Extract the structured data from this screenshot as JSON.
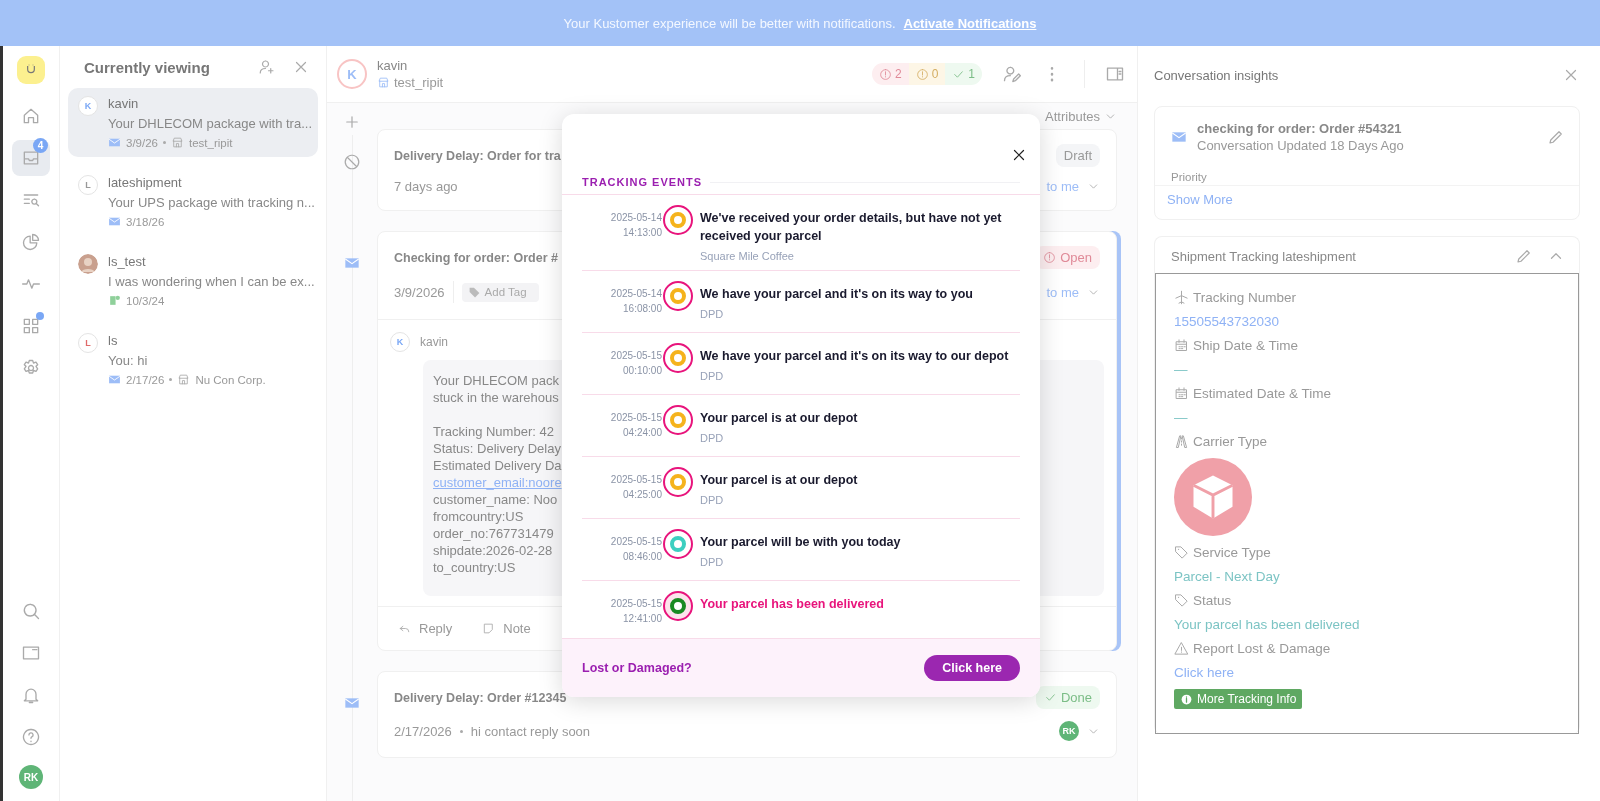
{
  "banner": {
    "text": "Your Kustomer experience will be better with notifications.",
    "link": "Activate Notifications"
  },
  "rail": {
    "top": [
      {
        "kind": "home",
        "selected": false
      },
      {
        "kind": "inbox",
        "selected": true,
        "badge": "4"
      },
      {
        "kind": "search-list",
        "selected": false
      },
      {
        "kind": "pie",
        "selected": false
      },
      {
        "kind": "pulse",
        "selected": false
      },
      {
        "kind": "apps",
        "selected": false,
        "dot": true
      },
      {
        "kind": "settings",
        "selected": false
      }
    ],
    "bottom": [
      {
        "kind": "search"
      },
      {
        "kind": "window"
      },
      {
        "kind": "bell"
      },
      {
        "kind": "help"
      }
    ],
    "user": "RK"
  },
  "list": {
    "title": "Currently viewing",
    "items": [
      {
        "kind": "email",
        "initial": "K",
        "color": "#7aa7f5",
        "name": "kavin",
        "preview": "Your DHLECOM package with tra...",
        "date": "3/9/26",
        "org": "test_ripit",
        "selected": true
      },
      {
        "kind": "email",
        "initial": "L",
        "color": "#999999",
        "name": "lateshipment",
        "preview": "Your UPS package with tracking n...",
        "date": "3/18/26",
        "selected": false
      },
      {
        "kind": "chat",
        "color": "#c9a08e",
        "name": "ls_test",
        "preview": "I was wondering when I can be ex...",
        "date": "10/3/24",
        "selected": false
      },
      {
        "kind": "email",
        "initial": "L",
        "color": "#e06a6a",
        "name": "ls",
        "preview": "You: hi",
        "date": "2/17/26",
        "org": "Nu Con Corp.",
        "selected": false
      }
    ]
  },
  "header": {
    "initial": "K",
    "name": "kavin",
    "org": "test_ripit",
    "counts": [
      {
        "kind": "urgent",
        "value": "2"
      },
      {
        "kind": "warning",
        "value": "0"
      },
      {
        "kind": "done",
        "value": "1"
      }
    ]
  },
  "filter": "Attributes",
  "cards": [
    {
      "kind": "draft",
      "title": "Delivery Delay: Order for tra",
      "status": "Draft",
      "date": "7 days ago",
      "assign": "to me",
      "selected": false
    },
    {
      "kind": "open",
      "title": "Checking for order: Order #",
      "status": "Open",
      "date": "3/9/2026",
      "tag": "Add Tag",
      "assign": "to me",
      "selected": true,
      "message": {
        "initial": "K",
        "author": "kavin",
        "lines": [
          {
            "text": "Your DHLECOM pack",
            "kind": "text"
          },
          {
            "text": "stuck in the warehous",
            "kind": "text"
          },
          {
            "kind": "gap"
          },
          {
            "text": "Tracking Number: 42",
            "kind": "text"
          },
          {
            "text": "Status: Delivery Delay",
            "kind": "text"
          },
          {
            "text": "Estimated Delivery Da",
            "kind": "text"
          },
          {
            "text": "customer_email:noore",
            "kind": "link"
          },
          {
            "text": "customer_name: Noo",
            "kind": "text"
          },
          {
            "text": "fromcountry:US",
            "kind": "text"
          },
          {
            "text": "order_no:767731479",
            "kind": "text"
          },
          {
            "text": "shipdate:2026-02-28",
            "kind": "text"
          },
          {
            "text": "to_country:US",
            "kind": "text"
          }
        ]
      },
      "actions": [
        {
          "kind": "reply",
          "label": "Reply"
        },
        {
          "kind": "note",
          "label": "Note"
        }
      ]
    },
    {
      "kind": "done",
      "title": "Delivery Delay: Order #12345",
      "status": "Done",
      "date": "2/17/2026",
      "preview": "hi contact reply soon",
      "assignee": "RK",
      "selected": false
    }
  ],
  "modal": {
    "section": "TRACKING EVENTS",
    "events": [
      {
        "date": "2025-05-14",
        "time": "14:13:00",
        "title": "We've received your order details, but have not yet received your parcel",
        "source": "Square Mile Coffee",
        "color": "#f5b31c",
        "kind": "normal"
      },
      {
        "date": "2025-05-14",
        "time": "16:08:00",
        "title": "We have your parcel and it's on its way to you",
        "source": "DPD",
        "color": "#f5b31c",
        "kind": "normal"
      },
      {
        "date": "2025-05-15",
        "time": "00:10:00",
        "title": "We have your parcel and it's on its way to our depot",
        "source": "DPD",
        "color": "#f5b31c",
        "kind": "normal"
      },
      {
        "date": "2025-05-15",
        "time": "04:24:00",
        "title": "Your parcel is at our depot",
        "source": "DPD",
        "color": "#f5b31c",
        "kind": "normal"
      },
      {
        "date": "2025-05-15",
        "time": "04:25:00",
        "title": "Your parcel is at our depot",
        "source": "DPD",
        "color": "#f5b31c",
        "kind": "normal"
      },
      {
        "date": "2025-05-15",
        "time": "08:46:00",
        "title": "Your parcel will be with you today",
        "source": "DPD",
        "color": "#3ccfc0",
        "kind": "normal"
      },
      {
        "date": "2025-05-15",
        "time": "12:41:00",
        "title": "Your parcel has been delivered",
        "color": "#1a8a22",
        "kind": "delivered"
      }
    ],
    "footer": "Lost or Damaged?",
    "button": "Click here"
  },
  "insights": {
    "title": "Conversation insights",
    "summary": {
      "subject": "checking for order: Order #54321",
      "updated": "Conversation Updated 18 Days Ago",
      "priority": "Priority",
      "more": "Show More"
    },
    "tracking": {
      "title": "Shipment Tracking lateshipment",
      "fields": [
        {
          "kind": "number",
          "label": "Tracking Number",
          "value": "15505543732030"
        },
        {
          "kind": "date",
          "label": "Ship Date & Time",
          "value": "—"
        },
        {
          "kind": "date",
          "label": "Estimated Date & Time",
          "value": "—"
        },
        {
          "kind": "carrier",
          "label": "Carrier Type"
        },
        {
          "kind": "service",
          "label": "Service Type",
          "value": "Parcel - Next Day"
        },
        {
          "kind": "status",
          "label": "Status",
          "value": "Your parcel has been delivered"
        },
        {
          "kind": "report",
          "label": "Report Lost & Damage",
          "value": "Click here"
        }
      ],
      "button": "More Tracking Info"
    }
  }
}
